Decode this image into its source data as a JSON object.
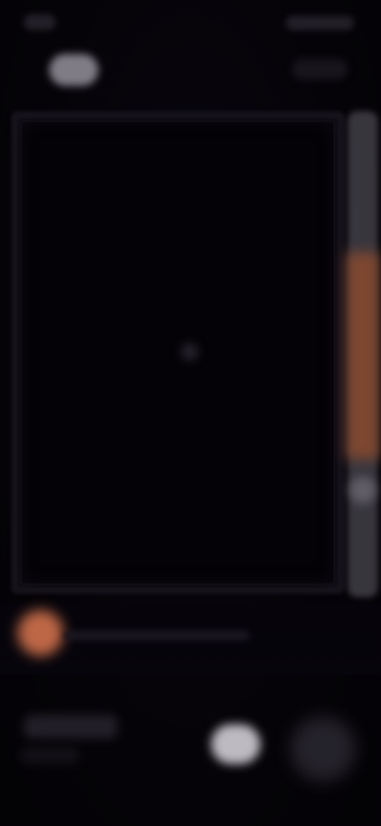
{
  "colors": {
    "background": "#07040a",
    "board": "#040206",
    "accent": "#c86d4a",
    "slider": "#4a4750",
    "pill": "#8e8a94"
  },
  "icons": {
    "status_left": "status-icon",
    "status_right": "status-icon",
    "top_left": "pill-button-icon",
    "top_right": "toolbar-icons",
    "record": "record-dot-icon",
    "center": "center-dot-icon",
    "slider_knob": "slider-knob-icon"
  }
}
